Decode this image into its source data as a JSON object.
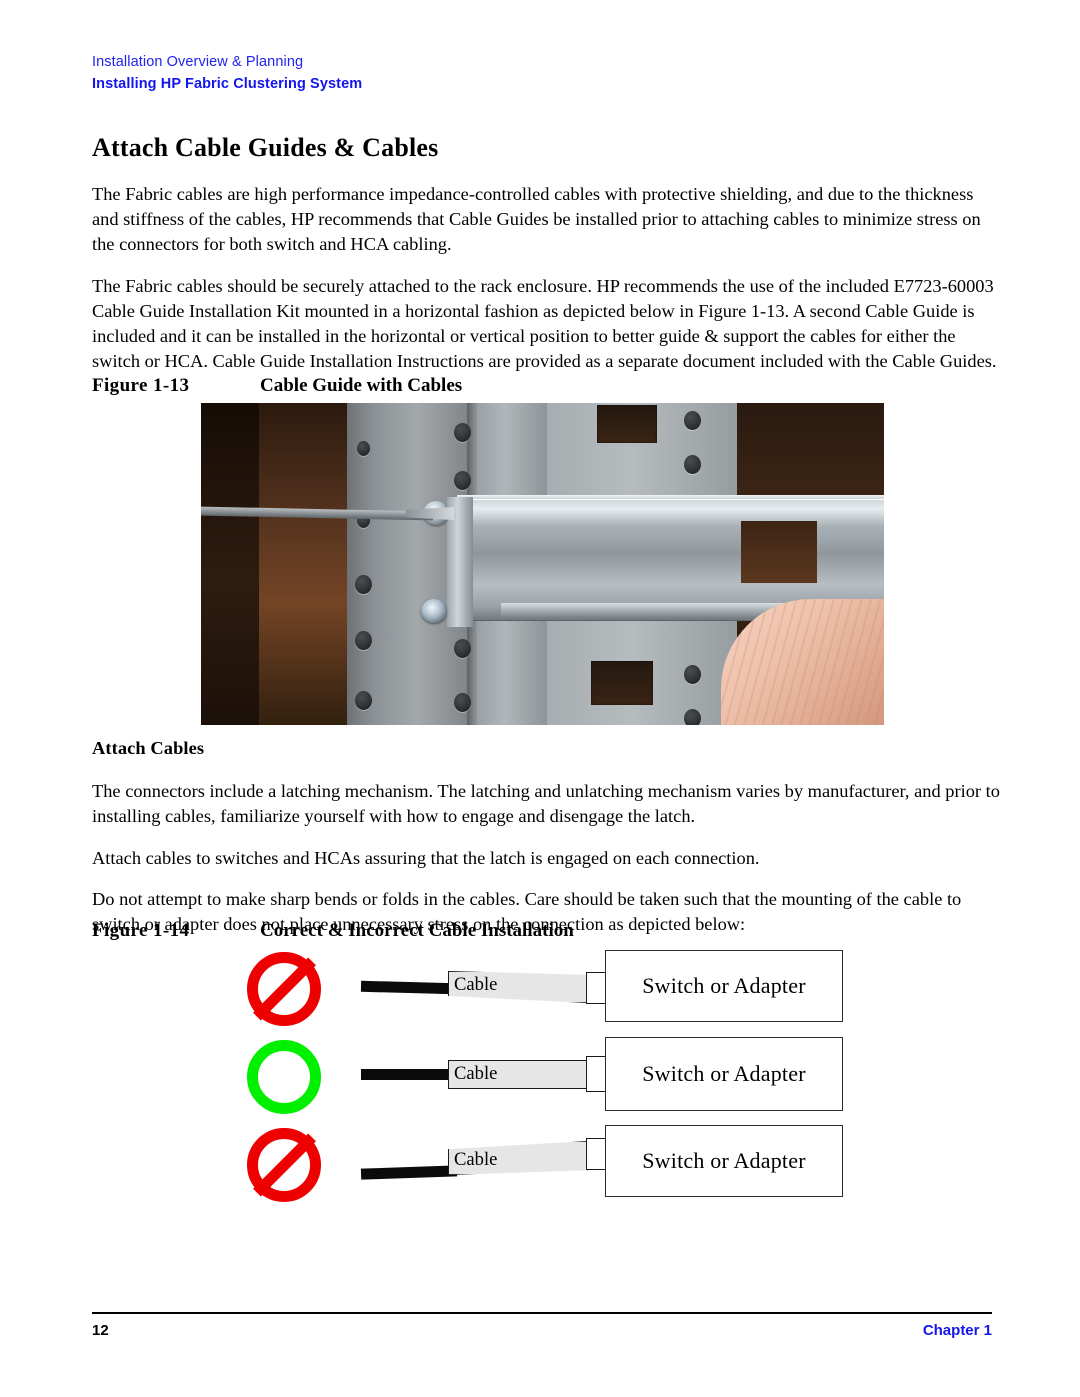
{
  "header": {
    "line1": "Installation Overview & Planning",
    "line2": "Installing HP Fabric Clustering System",
    "accent_color": "#1414ee"
  },
  "page_title": "Attach Cable Guides & Cables",
  "body": {
    "paragraph_1": "The Fabric cables are high performance impedance-controlled cables with protective shielding, and due to the thickness and stiffness of the cables, HP recommends that Cable Guides be installed prior to attaching cables to minimize stress on the connectors for both switch and HCA cabling.",
    "paragraph_2": "The Fabric cables should be securely attached to the rack enclosure. HP recommends the use of the included E7723-60003 Cable Guide Installation Kit mounted in a horizontal fashion as depicted below in Figure 1-13. A second Cable Guide is included and it can be installed in the horizontal or vertical position to better guide & support the cables for either the switch or HCA. Cable Guide Installation Instructions are provided as a separate document included with the Cable Guides.",
    "subheading_attach_cables": "Attach Cables",
    "paragraph_3": "The connectors include a latching mechanism. The latching and unlatching mechanism varies by manufacturer, and prior to installing cables, familiarize yourself with how to engage and disengage the latch.",
    "paragraph_4": "Attach cables to switches and HCAs assuring that the latch is engaged on each connection.",
    "paragraph_5": "Do not attempt to make sharp bends or folds in the cables. Care should be taken such that the mounting of the cable to switch or adapter does not place unnecessary stress on the connection as depicted below:"
  },
  "figure_13": {
    "number": "Figure 1-13",
    "title": "Cable Guide with Cables",
    "alt": "Photograph of a steel cable guide bar being screwed onto a grey server rack post, with a screwdriver at the upper screw and a hand supporting the bar at lower right."
  },
  "figure_14": {
    "number": "Figure 1-14",
    "title": "Correct & Incorrect Cable Installation",
    "rows": [
      {
        "status": "incorrect",
        "status_icon": "prohibited-icon",
        "status_color": "#ee0000",
        "cable_label": "Cable",
        "device_label": "Switch or Adapter",
        "bend": "down"
      },
      {
        "status": "correct",
        "status_icon": "circle-icon",
        "status_color": "#00f000",
        "cable_label": "Cable",
        "device_label": "Switch or Adapter",
        "bend": "straight"
      },
      {
        "status": "incorrect",
        "status_icon": "prohibited-icon",
        "status_color": "#ee0000",
        "cable_label": "Cable",
        "device_label": "Switch or Adapter",
        "bend": "up"
      }
    ]
  },
  "footer": {
    "page_number": "12",
    "chapter": "Chapter 1",
    "chapter_color": "#1414ee"
  }
}
